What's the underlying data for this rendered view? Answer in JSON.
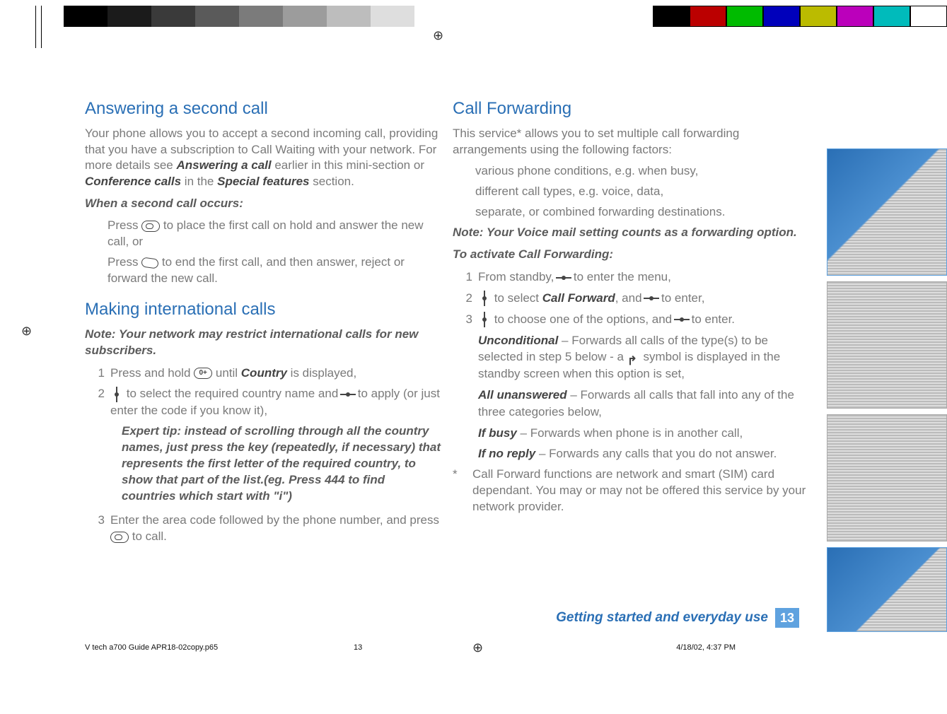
{
  "left": {
    "h1": "Answering a second call",
    "intro": [
      "Your phone allows you to accept a second incoming call, providing that you have a subscription to Call Waiting with your network. For more details see ",
      "Answering a call",
      " earlier in this mini-section or ",
      "Conference calls",
      " in the ",
      "Special features",
      " section."
    ],
    "sub1": "When a second call occurs:",
    "b1a": " to place the first call on hold and answer the new call, or",
    "b1b": " to end the first call, and then answer, reject or forward the new call.",
    "h2": "Making international calls",
    "note2": "Note: Your network may restrict international calls for new subscribers.",
    "s1_pre": "Press and hold ",
    "s1_mid": " until ",
    "s1_xref": "Country",
    "s1_post": " is displayed,",
    "s2_pre": " to select the required country name and ",
    "s2_post": " to apply (or just enter the code if you know it),",
    "expert": "Expert tip: instead of scrolling through all the country names, just press the key (repeatedly, if necessary) that represents the first letter of the required country, to show that part of the list.(eg. Press 444 to find countries which start with \"i\")",
    "s3_pre": "Enter the area code followed by the phone number, and press ",
    "s3_post": " to call."
  },
  "right": {
    "h1": "Call  Forwarding",
    "intro": "This service* allows you to set multiple call forwarding arrangements using the following factors:",
    "factors": [
      "various phone conditions, e.g. when busy,",
      "different call types, e.g. voice, data,",
      "separate, or combined forwarding destinations."
    ],
    "note": "Note: Your Voice mail setting counts as a forwarding option.",
    "sub": "To activate Call Forwarding:",
    "s1_pre": "From standby, ",
    "s1_post": " to enter the menu,",
    "s2_pre": " to select ",
    "s2_xref": "Call Forward",
    "s2_mid": ", and ",
    "s2_post": " to enter,",
    "s3_pre": " to choose one of the options, and ",
    "s3_post": " to enter.",
    "opts": [
      {
        "t": "Unconditional",
        "d_pre": " –  Forwards all calls of the type(s) to be selected in step 5 below - a ",
        "d_post": " symbol is displayed in the standby screen when this option is set,"
      },
      {
        "t": "All unanswered",
        "d": " –  Forwards all calls that fall into any of the three categories below,"
      },
      {
        "t": "If busy",
        "d": " –  Forwards when phone is in another call,"
      },
      {
        "t": "If no reply",
        "d": " –  Forwards any calls that you do not answer."
      }
    ],
    "star": "Call Forward functions are network and smart (SIM) card dependant. You may or may not be offered this service by your network provider."
  },
  "footer": {
    "section": "Getting started and everyday use",
    "page": "13",
    "file": "V tech a700 Guide APR18-02copy.p65",
    "sheet": "13",
    "stamp": "4/18/02, 4:37 PM"
  }
}
